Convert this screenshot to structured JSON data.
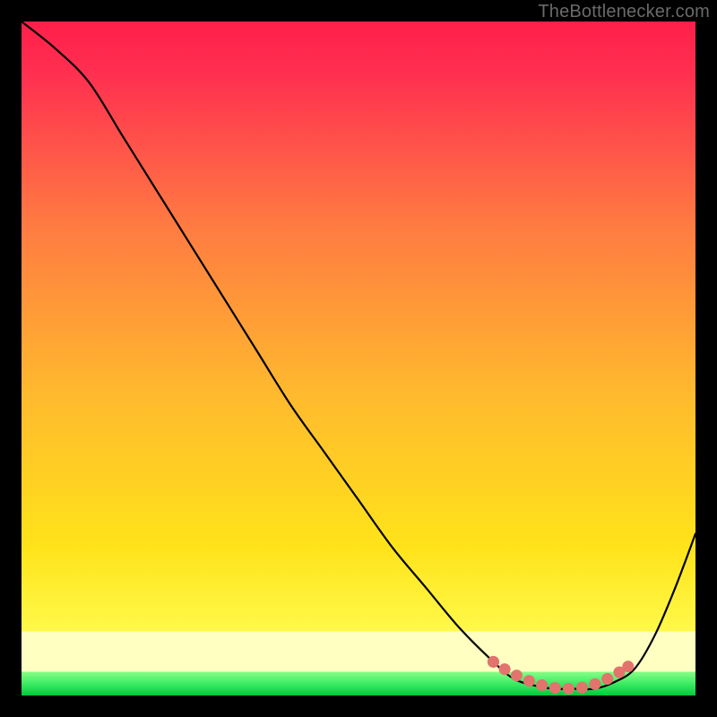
{
  "attribution": "TheBottlenecker.com",
  "colors": {
    "top_gradient": "#ff1f4a",
    "mid_gradient": "#ffde00",
    "pale_band": "#ffffbf",
    "green_band_top": "#7aff7a",
    "green_band_bottom": "#00d63f",
    "curve": "#000000",
    "dots": "#e2736d",
    "background": "#000000",
    "attribution_text": "#6a6a6a"
  },
  "chart_data": {
    "type": "line",
    "title": "",
    "xlabel": "",
    "ylabel": "",
    "xlim": [
      0,
      100
    ],
    "ylim": [
      0,
      100
    ],
    "grid": false,
    "legend": false,
    "series": [
      {
        "name": "bottleneck-curve",
        "x": [
          0,
          5,
          10,
          15,
          20,
          25,
          30,
          35,
          40,
          45,
          50,
          55,
          60,
          65,
          70,
          73,
          76,
          79,
          82,
          85,
          88,
          91,
          94,
          97,
          100
        ],
        "y": [
          100,
          96,
          91,
          83,
          75,
          67,
          59,
          51,
          43,
          36,
          29,
          22,
          16,
          10,
          5,
          2.5,
          1.5,
          1,
          1,
          1,
          2,
          4,
          9,
          16,
          24
        ]
      }
    ],
    "optimal_zone": {
      "name": "optimal-range-dots",
      "x": [
        70,
        72,
        74,
        76,
        78,
        80,
        82,
        84,
        86,
        88,
        90
      ],
      "y": [
        5,
        3.7,
        2.7,
        1.9,
        1.3,
        1,
        1,
        1.3,
        2,
        3,
        4.3
      ]
    }
  }
}
